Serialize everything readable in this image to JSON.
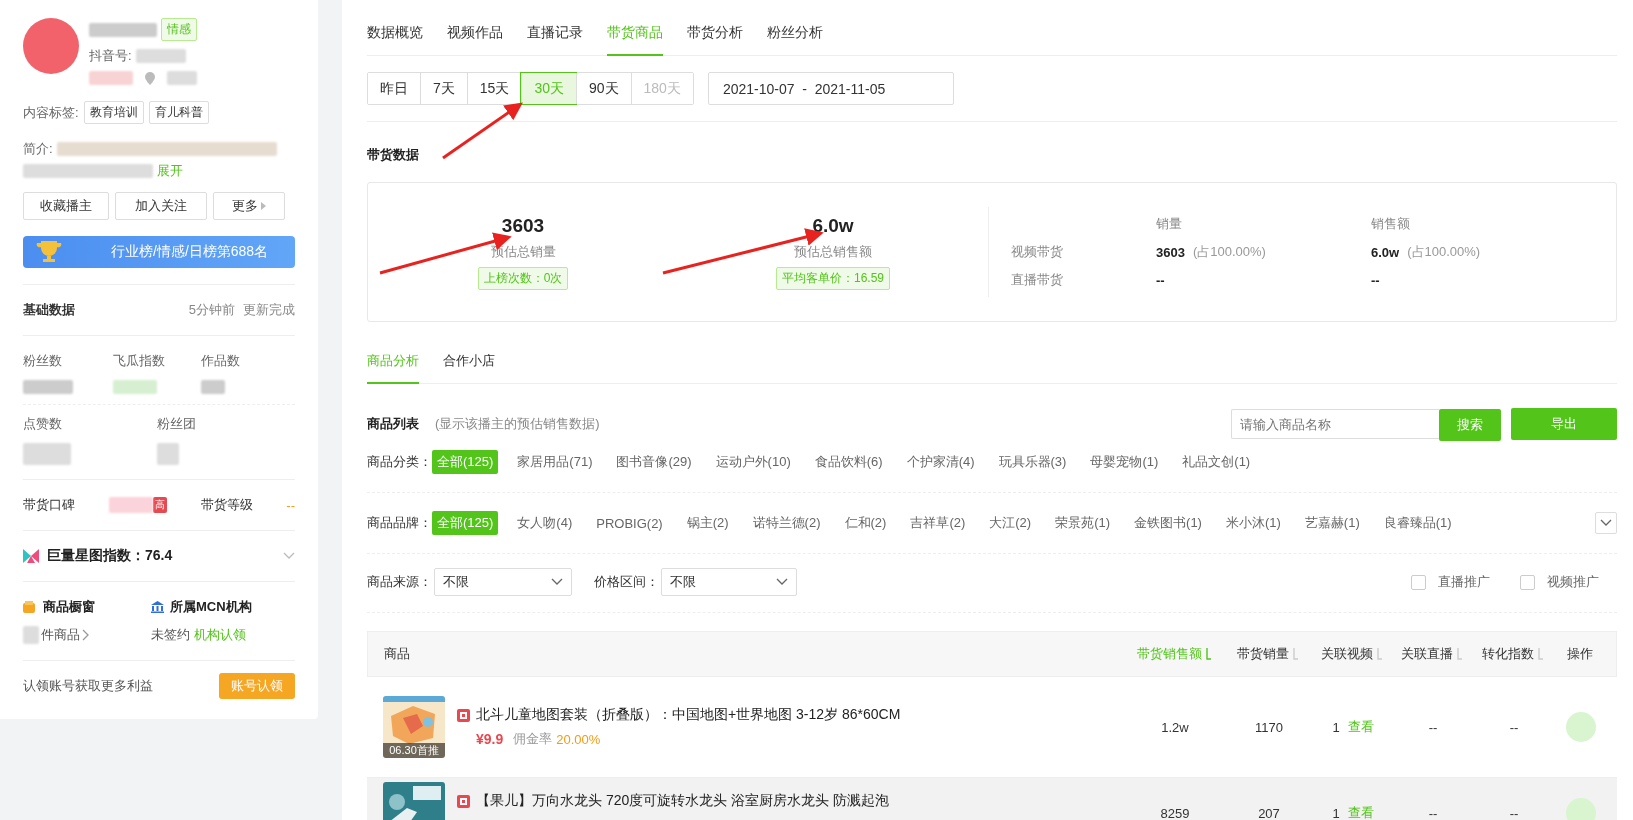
{
  "profile": {
    "tag": "情感",
    "douyin_label": "抖音号:",
    "content_tags_label": "内容标签:",
    "content_tags": [
      "教育培训",
      "育儿科普"
    ],
    "intro_label": "简介:",
    "expand": "展开",
    "actions": [
      "收藏播主",
      "加入关注",
      "更多"
    ],
    "rank": "行业榜/情感/日榜第688名"
  },
  "basic_data": {
    "title": "基础数据",
    "updated": "5分钟前",
    "status": "更新完成",
    "stats_row1": [
      "粉丝数",
      "飞瓜指数",
      "作品数"
    ],
    "stats_row2": [
      "点赞数",
      "粉丝团"
    ]
  },
  "reputation": {
    "label": "带货口碑",
    "badge": "高",
    "level_label": "带货等级",
    "level": "--"
  },
  "star_index": {
    "text": "巨量星图指数：76.4",
    "expanded": false
  },
  "shop": {
    "title": "商品橱窗",
    "count_text": "件商品"
  },
  "mcn": {
    "title": "所属MCN机构",
    "status": "未签约",
    "link": "机构认领"
  },
  "claim": {
    "text": "认领账号获取更多利益",
    "button": "账号认领"
  },
  "tabs": [
    {
      "label": "数据概览",
      "selected": false
    },
    {
      "label": "视频作品",
      "selected": false
    },
    {
      "label": "直播记录",
      "selected": false
    },
    {
      "label": "带货商品",
      "selected": true
    },
    {
      "label": "带货分析",
      "selected": false
    },
    {
      "label": "粉丝分析",
      "selected": false
    }
  ],
  "ranges": [
    {
      "label": "昨日",
      "selected": false,
      "disabled": false
    },
    {
      "label": "7天",
      "selected": false,
      "disabled": false
    },
    {
      "label": "15天",
      "selected": false,
      "disabled": false
    },
    {
      "label": "30天",
      "selected": true,
      "disabled": false
    },
    {
      "label": "90天",
      "selected": false,
      "disabled": false
    },
    {
      "label": "180天",
      "selected": false,
      "disabled": true
    }
  ],
  "date_range": "2021-10-07  -  2021-11-05",
  "section_title": "带货数据",
  "summary": [
    {
      "value": "3603",
      "label": "预估总销量",
      "badge": "上榜次数：0次"
    },
    {
      "value": "6.0w",
      "label": "预估总销售额",
      "badge": "平均客单价：16.59"
    }
  ],
  "breakdown": {
    "columns": [
      "销量",
      "销售额"
    ],
    "rows": [
      {
        "label": "视频带货",
        "sales": "3603",
        "sales_share": "(占100.00%)",
        "amount": "6.0w",
        "amount_share": "(占100.00%)"
      },
      {
        "label": "直播带货",
        "sales": "--",
        "amount": "--"
      }
    ]
  },
  "subtabs": [
    {
      "label": "商品分析",
      "selected": true
    },
    {
      "label": "合作小店",
      "selected": false
    }
  ],
  "product_list": {
    "title": "商品列表",
    "note": "(显示该播主的预估销售数据)",
    "search_placeholder": "请输入商品名称",
    "search_button": "搜索",
    "export_button": "导出"
  },
  "filters": [
    {
      "label": "商品分类：",
      "options": [
        {
          "label": "全部(125)",
          "selected": true
        },
        {
          "label": "家居用品(71)",
          "selected": false
        },
        {
          "label": "图书音像(29)",
          "selected": false
        },
        {
          "label": "运动户外(10)",
          "selected": false
        },
        {
          "label": "食品饮料(6)",
          "selected": false
        },
        {
          "label": "个护家清(4)",
          "selected": false
        },
        {
          "label": "玩具乐器(3)",
          "selected": false
        },
        {
          "label": "母婴宠物(1)",
          "selected": false
        },
        {
          "label": "礼品文创(1)",
          "selected": false
        }
      ]
    },
    {
      "label": "商品品牌：",
      "options": [
        {
          "label": "全部(125)",
          "selected": true
        },
        {
          "label": "女人吻(4)",
          "selected": false
        },
        {
          "label": "PROBIG(2)",
          "selected": false
        },
        {
          "label": "锅主(2)",
          "selected": false
        },
        {
          "label": "诺特兰德(2)",
          "selected": false
        },
        {
          "label": "仁和(2)",
          "selected": false
        },
        {
          "label": "吉祥草(2)",
          "selected": false
        },
        {
          "label": "大江(2)",
          "selected": false
        },
        {
          "label": "荣景苑(1)",
          "selected": false
        },
        {
          "label": "金铁图书(1)",
          "selected": false
        },
        {
          "label": "米小沐(1)",
          "selected": false
        },
        {
          "label": "艺嘉赫(1)",
          "selected": false
        },
        {
          "label": "良睿臻品(1)",
          "selected": false
        }
      ],
      "more": true
    }
  ],
  "selects": [
    {
      "label": "商品来源：",
      "value": "不限"
    },
    {
      "label": "价格区间：",
      "value": "不限"
    }
  ],
  "checkboxes": [
    {
      "label": "直播推广",
      "checked": false
    },
    {
      "label": "视频推广",
      "checked": false
    }
  ],
  "table": {
    "columns": [
      {
        "label": "商品",
        "sortable": false,
        "selected": false
      },
      {
        "label": "带货销售额",
        "sortable": true,
        "selected": true
      },
      {
        "label": "带货销量",
        "sortable": true,
        "selected": false
      },
      {
        "label": "关联视频",
        "sortable": true,
        "selected": false
      },
      {
        "label": "关联直播",
        "sortable": true,
        "selected": false
      },
      {
        "label": "转化指数",
        "sortable": true,
        "selected": false
      },
      {
        "label": "操作",
        "sortable": false,
        "selected": false
      }
    ],
    "rows": [
      {
        "title": "北斗儿童地图套装（折叠版）：中国地图+世界地图 3-12岁 86*60CM",
        "thumb_label": "06.30首推",
        "price": "¥9.9",
        "commission_label": "佣金率",
        "commission": "20.00%",
        "sales_amount": "1.2w",
        "sales": "1170",
        "videos": "1",
        "view": "查看",
        "live": "--",
        "conversion": "--",
        "selected": false
      },
      {
        "title": "【果儿】万向水龙头 720度可旋转水龙头 浴室厨房水龙头 防溅起泡",
        "sales_amount": "8259",
        "sales": "207",
        "videos": "1",
        "view": "查看",
        "live": "--",
        "conversion": "--",
        "selected": true
      }
    ]
  }
}
